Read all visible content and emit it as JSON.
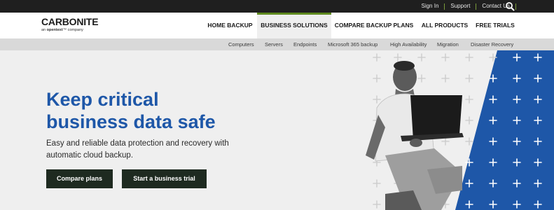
{
  "utility": {
    "links": [
      "Sign In",
      "Support",
      "Contact Us"
    ],
    "search_icon": "search-icon"
  },
  "logo": {
    "brand": "CARBONITE",
    "sub_prefix": "an ",
    "sub_brand": "opentext",
    "sub_suffix": "™ company"
  },
  "nav": {
    "items": [
      "HOME BACKUP",
      "BUSINESS SOLUTIONS",
      "COMPARE BACKUP PLANS",
      "ALL PRODUCTS",
      "FREE TRIALS"
    ],
    "active": "BUSINESS SOLUTIONS"
  },
  "subnav": {
    "items": [
      "Computers",
      "Servers",
      "Endpoints",
      "Microsoft 365 backup",
      "High Availability",
      "Migration",
      "Disaster Recovery"
    ]
  },
  "hero": {
    "headline_line1": "Keep critical",
    "headline_line2": "business data safe",
    "subtext_line1": "Easy and reliable data protection and recovery with",
    "subtext_line2": "automatic cloud backup.",
    "cta_primary": "Compare plans",
    "cta_secondary": "Start a business trial"
  },
  "colors": {
    "accent_blue": "#1e57a8",
    "accent_green": "#5f8a1f",
    "button_dark": "#1e2a20",
    "top_bar": "#1f1f1f"
  }
}
